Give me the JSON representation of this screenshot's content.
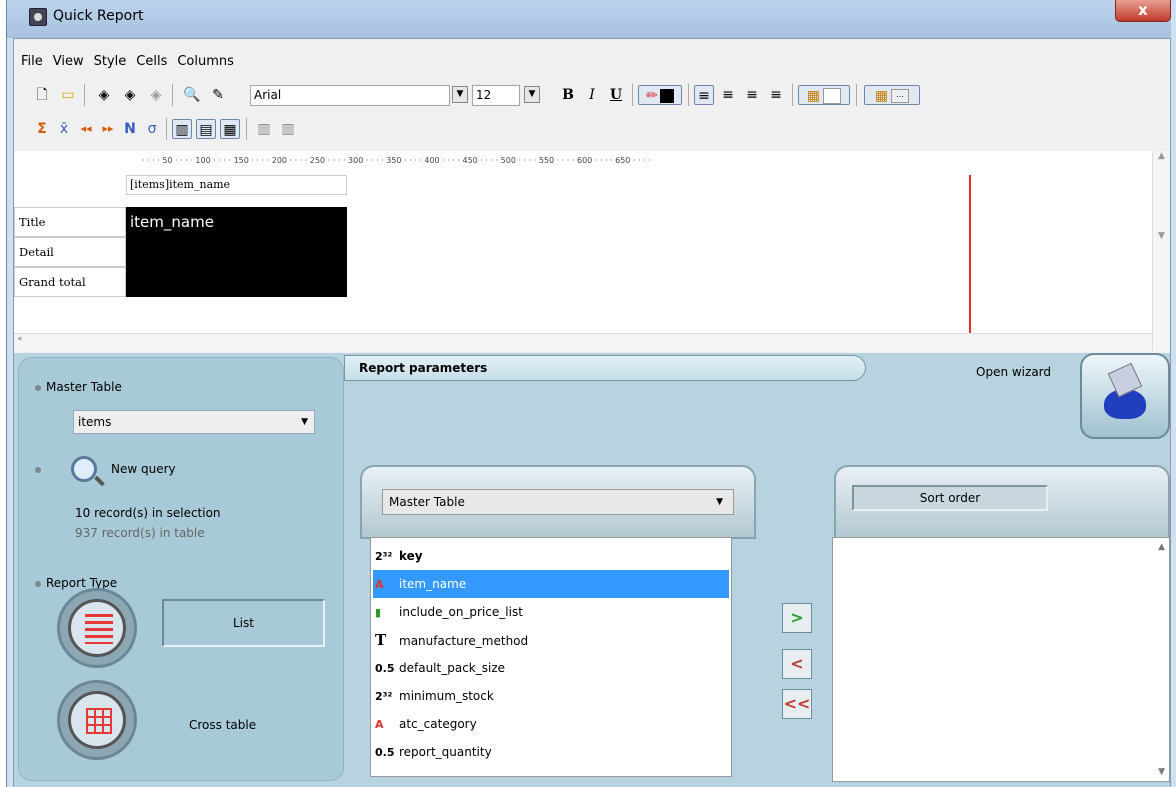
{
  "window": {
    "title": "Quick Report",
    "close_glyph": "x"
  },
  "menu": [
    "File",
    "View",
    "Style",
    "Cells",
    "Columns"
  ],
  "toolbar": {
    "font_name": "Arial",
    "font_size": "12",
    "bold": "B",
    "italic": "I",
    "underline": "U"
  },
  "toolbar2": {
    "sigma": "Σ",
    "n": "N",
    "sigma_small": "σ"
  },
  "ruler": "· · · · 50 · · · · 100 · · · · 150 · · · · 200 · · · · 250 · · · · 300 · · · · 350 · · · · 400 · · · · 450 · · · · 500 · · · · 550 · · · · 600 · · · · 650 · · · ·",
  "report_design": {
    "column_header": "[items]item_name",
    "rows": [
      "Title",
      "Detail",
      "Grand total"
    ],
    "title_cell": "item_name"
  },
  "left_panel": {
    "master_table_label": "Master Table",
    "master_table_value": "items",
    "new_query_label": "New query",
    "records_in_selection": "10 record(s) in selection",
    "records_in_table": "937 record(s) in table",
    "report_type_label": "Report Type",
    "list_label": "List",
    "cross_table_label": "Cross table"
  },
  "params": {
    "tab_label": "Report parameters",
    "open_wizard": "Open wizard",
    "table_select": "Master Table",
    "sort_order": "Sort order",
    "fields": [
      {
        "icon": "2³²",
        "name": "key",
        "bold": true
      },
      {
        "icon": "A",
        "name": "item_name",
        "selected": true
      },
      {
        "icon": "▮",
        "name": "include_on_price_list"
      },
      {
        "icon": "T",
        "name": "manufacture_method"
      },
      {
        "icon": "0.5",
        "name": "default_pack_size"
      },
      {
        "icon": "2³²",
        "name": "minimum_stock"
      },
      {
        "icon": "A",
        "name": "atc_category"
      },
      {
        "icon": "0.5",
        "name": "report_quantity"
      }
    ],
    "add_glyph": ">",
    "remove_glyph": "<",
    "remove_all_glyph": "<<"
  },
  "colors": {
    "accent_selected": "#3399ff",
    "red": "#e03030"
  }
}
